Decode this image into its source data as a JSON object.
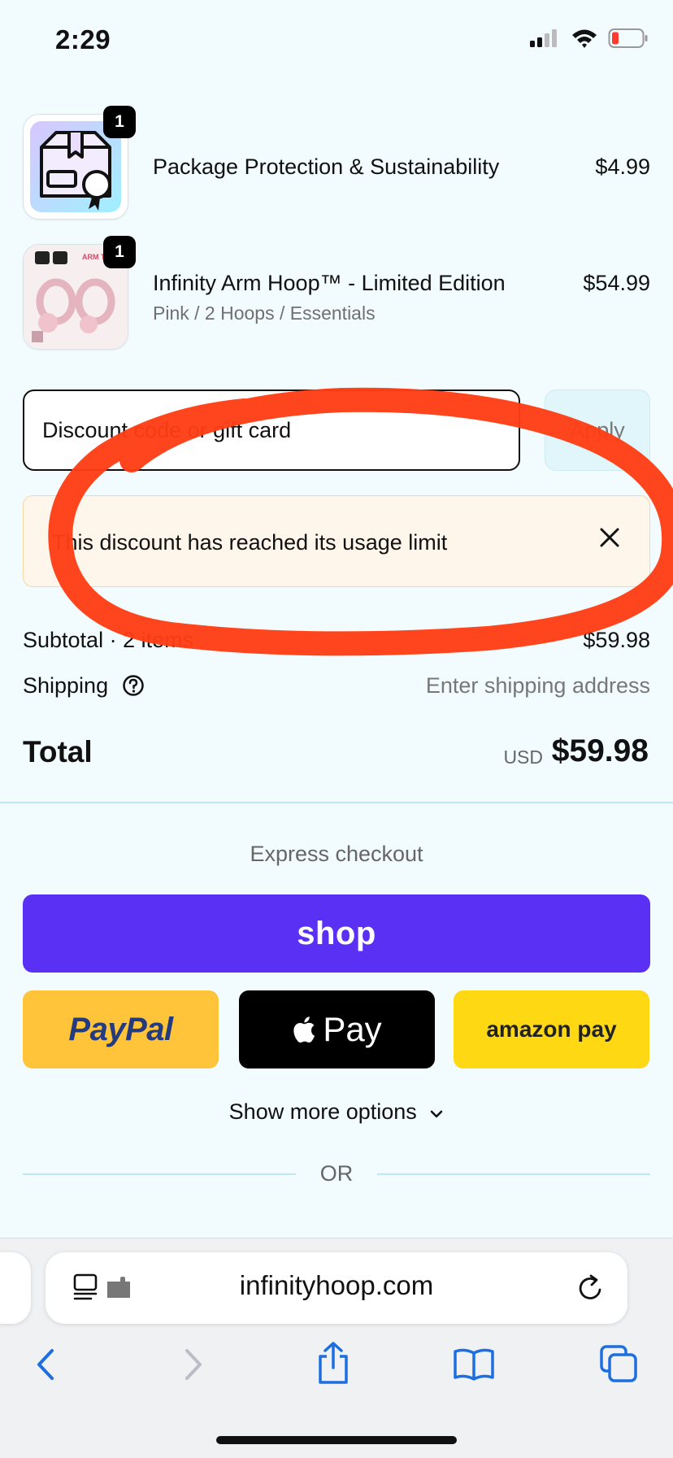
{
  "status_bar": {
    "time": "2:29"
  },
  "line_items": [
    {
      "quantity": "1",
      "name": "Package Protection & Sustainability",
      "variant": "",
      "price": "$4.99"
    },
    {
      "quantity": "1",
      "name": "Infinity Arm Hoop™ - Limited Edition",
      "variant": "Pink / 2 Hoops / Essentials",
      "price": "$54.99"
    }
  ],
  "discount": {
    "placeholder": "Discount code or gift card",
    "apply_label": "Apply",
    "error_message": "This discount has reached its usage limit"
  },
  "summary": {
    "subtotal_label": "Subtotal · 2 items",
    "subtotal_value": "$59.98",
    "shipping_label": "Shipping",
    "shipping_value": "Enter shipping address",
    "total_label": "Total",
    "currency": "USD",
    "total_value": "$59.98"
  },
  "express": {
    "heading": "Express checkout",
    "shop_label": "shop",
    "paypal_label": "PayPal",
    "apple_pay_label": "Pay",
    "amazon_pay_label": "amazon pay",
    "more_options": "Show more options",
    "or_label": "OR"
  },
  "browser": {
    "url": "infinityhoop.com"
  },
  "colors": {
    "background": "#f2fbfd",
    "shop_purple": "#5a31f4",
    "paypal_yellow": "#ffc439",
    "amazon_yellow": "#ffd814",
    "banner_bg": "#fff6eb",
    "annotation_red": "#ff3d14",
    "safari_blue": "#1d6fe0"
  }
}
